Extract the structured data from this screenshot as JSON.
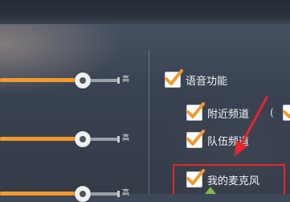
{
  "volume_sliders": [
    {
      "level_fraction": 0.69,
      "max_label": "高"
    },
    {
      "level_fraction": 0.69,
      "max_label": "高"
    },
    {
      "level_fraction": 0.69,
      "max_label": "高"
    }
  ],
  "voice": {
    "header_label": "语音功能",
    "header_checked": true,
    "options": [
      {
        "label": "附近频道",
        "checked": true
      },
      {
        "label": "队伍频道",
        "checked": true
      },
      {
        "label": "我的麦克风",
        "checked": true
      }
    ],
    "partial_text": "(",
    "partial_checked": true
  },
  "colors": {
    "accent_orange": "#f19a2e",
    "annotation_red": "#e8262a"
  },
  "icons": [
    "checkmark-icon",
    "slider-knob-icon",
    "annotation-arrow-icon"
  ]
}
